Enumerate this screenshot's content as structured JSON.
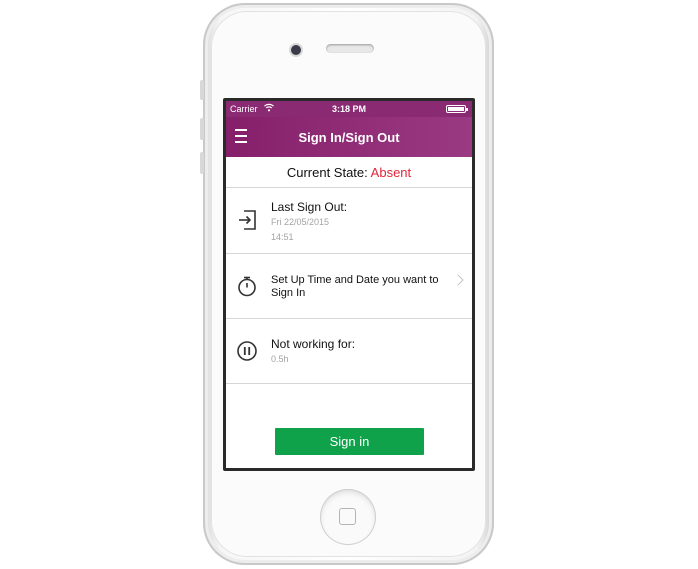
{
  "status_bar": {
    "carrier": "Carrier",
    "time": "3:18 PM",
    "battery_level": 1.0
  },
  "nav": {
    "title": "Sign In/Sign Out",
    "menu_icon": "hamburger-icon"
  },
  "state": {
    "label": "Current State:",
    "value": "Absent"
  },
  "rows": {
    "last_sign_out": {
      "icon": "sign-out-icon",
      "title": "Last Sign Out:",
      "date": "Fri 22/05/2015",
      "time": "14:51"
    },
    "schedule": {
      "icon": "stopwatch-icon",
      "title_line1": "Set Up Time and Date you want to",
      "title_line2": "Sign In"
    },
    "not_working": {
      "icon": "pause-icon",
      "title": "Not working for:",
      "value": "0.5h"
    }
  },
  "button": {
    "label": "Sign in"
  },
  "colors": {
    "nav_bar": "#8a2a72",
    "absent_text": "#e0263a",
    "sign_in_button": "#0fa24b"
  }
}
